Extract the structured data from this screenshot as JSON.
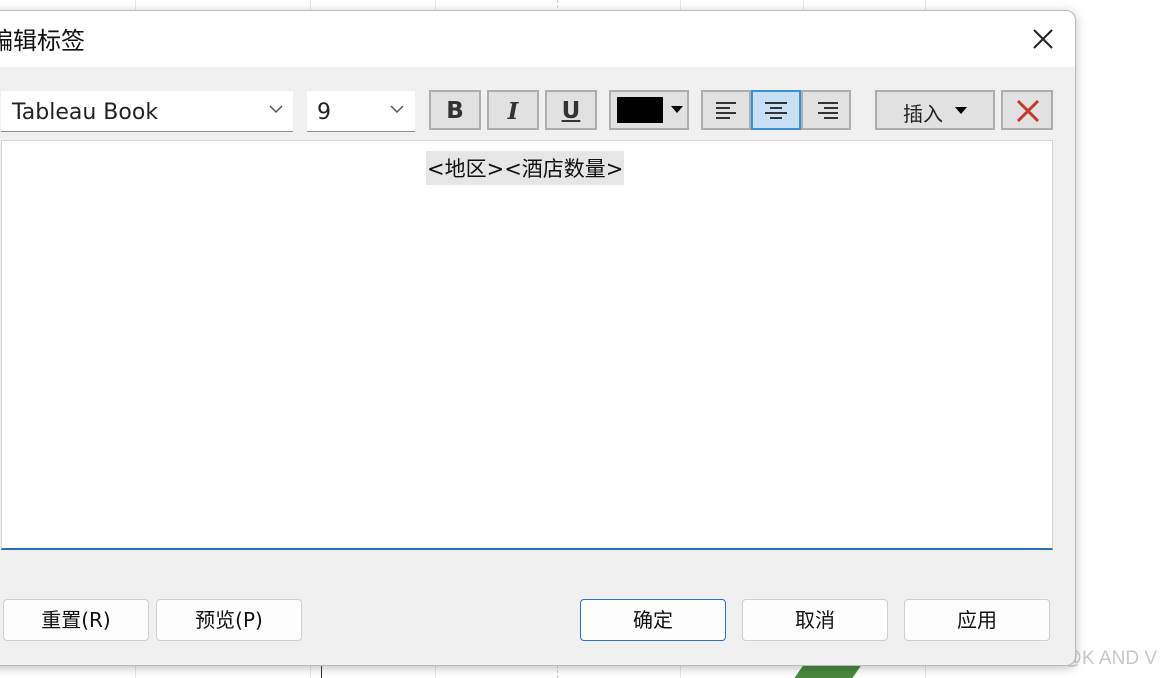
{
  "dialog": {
    "title": "编辑标签",
    "close_icon": "close-icon"
  },
  "toolbar": {
    "font_value": "Tableau Book",
    "font_size_value": "9",
    "bold_label": "B",
    "italic_label": "I",
    "underline_label": "U",
    "text_color": "#000000",
    "align_left_icon": "align-left-icon",
    "align_center_icon": "align-center-icon",
    "align_right_icon": "align-right-icon",
    "align_selected": "center",
    "insert_label": "插入",
    "clear_icon": "clear-icon",
    "clear_color": "#c0392b"
  },
  "editor": {
    "content": "<地区><酒店数量>"
  },
  "buttons": {
    "reset_label": "重置(R)",
    "preview_label": "预览(P)",
    "ok_label": "确定",
    "cancel_label": "取消",
    "apply_label": "应用"
  },
  "colors": {
    "accent": "#2b6fb8",
    "selected_bg": "#c8e0f6"
  },
  "watermark": "CSDN @K AND V"
}
